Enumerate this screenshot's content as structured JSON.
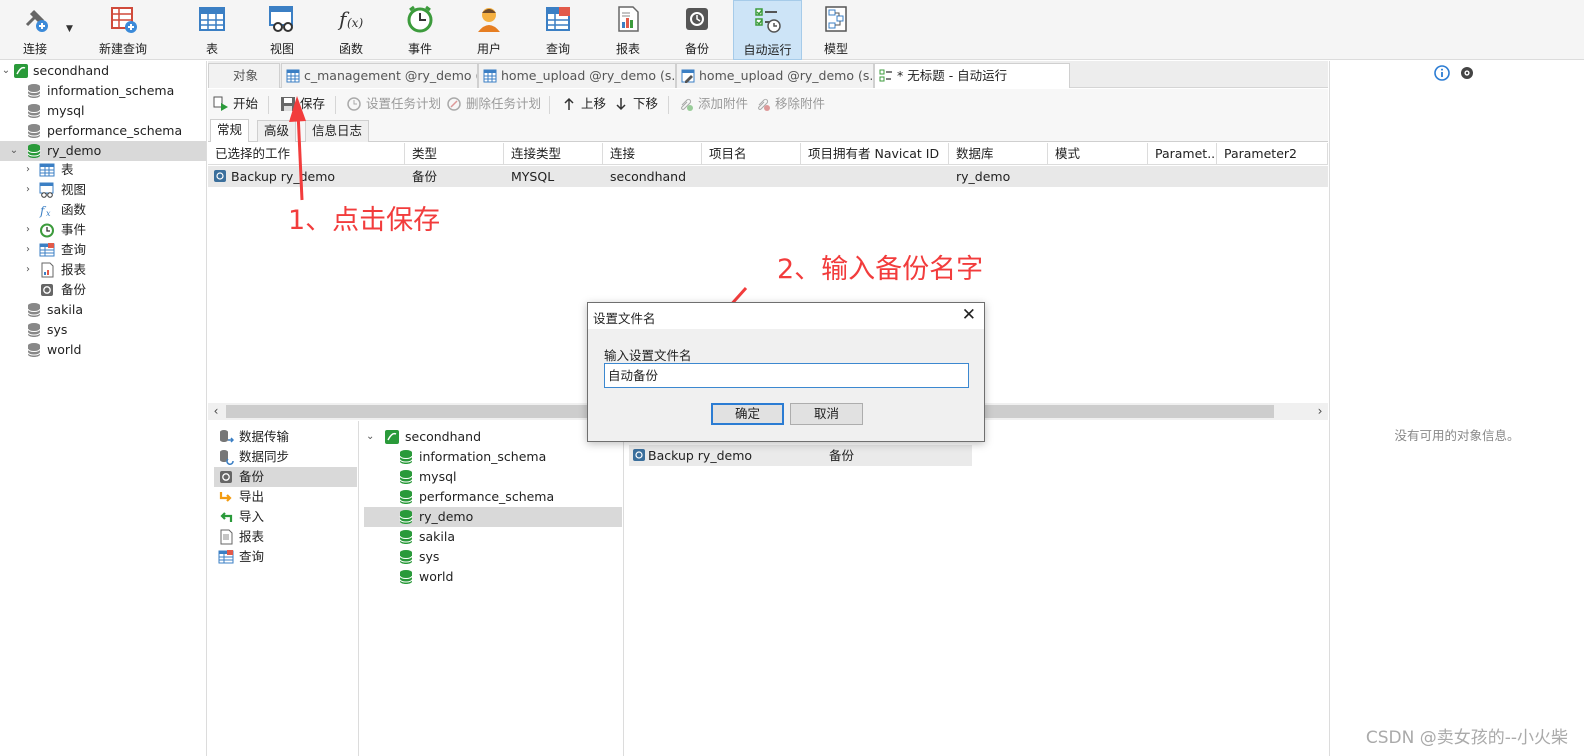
{
  "toolbar": {
    "connect": "连接",
    "new_query": "新建查询",
    "table": "表",
    "view": "视图",
    "function": "函数",
    "event": "事件",
    "user": "用户",
    "query": "查询",
    "report": "报表",
    "backup": "备份",
    "automation": "自动运行",
    "model": "模型"
  },
  "tree": {
    "root": "secondhand",
    "dbs": [
      "information_schema",
      "mysql",
      "performance_schema",
      "ry_demo",
      "sakila",
      "sys",
      "world"
    ],
    "children": [
      "表",
      "视图",
      "函数",
      "事件",
      "查询",
      "报表",
      "备份"
    ]
  },
  "tabs": {
    "objects": "对象",
    "tab1": "c_management @ry_demo (...",
    "tab2": "home_upload @ry_demo (s...",
    "tab3": "home_upload @ry_demo (s...",
    "tab4": "* 无标题 - 自动运行"
  },
  "actions": {
    "start": "开始",
    "save": "保存",
    "set_schedule": "设置任务计划",
    "delete_schedule": "删除任务计划",
    "move_up": "上移",
    "move_down": "下移",
    "add_attachment": "添加附件",
    "remove_attachment": "移除附件"
  },
  "subtabs": [
    "常规",
    "高级",
    "信息日志"
  ],
  "grid": {
    "headers": [
      "已选择的工作",
      "类型",
      "连接类型",
      "连接",
      "项目名",
      "项目拥有者 Navicat ID",
      "数据库",
      "模式",
      "Paramet...",
      "Parameter2"
    ],
    "rows": [
      [
        "Backup ry_demo",
        "备份",
        "MYSQL",
        "secondhand",
        "",
        "",
        "ry_demo",
        "",
        "",
        ""
      ]
    ]
  },
  "job_types": [
    "数据传输",
    "数据同步",
    "备份",
    "导出",
    "导入",
    "报表",
    "查询"
  ],
  "mid_tree": {
    "root": "secondhand",
    "dbs": [
      "information_schema",
      "mysql",
      "performance_schema",
      "ry_demo",
      "sakila",
      "sys",
      "world"
    ]
  },
  "available": {
    "name": "Backup ry_demo",
    "type": "备份"
  },
  "right_panel": {
    "no_info": "没有可用的对象信息。"
  },
  "dialog": {
    "title": "设置文件名",
    "label": "输入设置文件名",
    "value": "自动备份",
    "ok": "确定",
    "cancel": "取消"
  },
  "annotations": {
    "step1": "1、点击保存",
    "step2": "2、输入备份名字"
  },
  "watermark": "CSDN @卖女孩的--小火柴",
  "colors": {
    "annotation": "#f23c3c",
    "selection": "#d9d9d9",
    "active_toolbar": "#cde4f7",
    "db_green": "#2a9a3a",
    "focus_blue": "#2b7cd3"
  }
}
